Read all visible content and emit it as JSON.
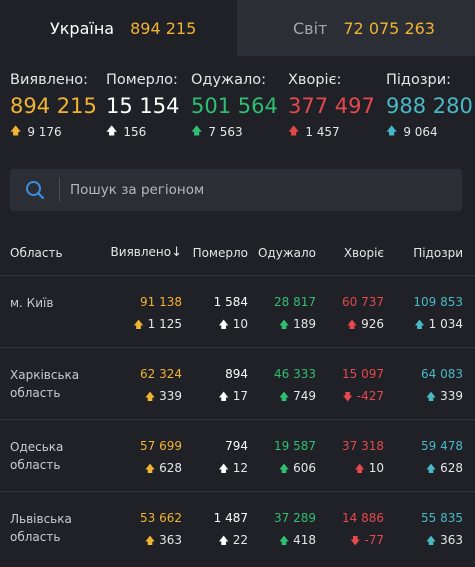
{
  "tabs": [
    {
      "name": "Україна",
      "value": "894 215"
    },
    {
      "name": "Світ",
      "value": "72 075 263"
    }
  ],
  "stats": [
    {
      "label": "Виявлено:",
      "value": "894 215",
      "delta": "9 176",
      "color": "#f2b233"
    },
    {
      "label": "Померло:",
      "value": "15 154",
      "delta": "156",
      "color": "#ffffff"
    },
    {
      "label": "Одужало:",
      "value": "501 564",
      "delta": "7 563",
      "color": "#2fbf71"
    },
    {
      "label": "Хворіє:",
      "value": "377 497",
      "delta": "1 457",
      "color": "#e5484d"
    },
    {
      "label": "Підозри:",
      "value": "988 280",
      "delta": "9 064",
      "color": "#48b9c7"
    }
  ],
  "search": {
    "placeholder": "Пошук за регіоном"
  },
  "table": {
    "headers": [
      "Область",
      "Виявлено",
      "Померло",
      "Одужало",
      "Хворіє",
      "Підозри"
    ],
    "rows": [
      {
        "region": "м. Київ",
        "cases": "91 138",
        "cases_d": "1 125",
        "deaths": "1 584",
        "deaths_d": "10",
        "recovered": "28 817",
        "recovered_d": "189",
        "sick": "60 737",
        "sick_d": "926",
        "suspected": "109 853",
        "suspected_d": "1 034",
        "sick_dir": "up"
      },
      {
        "region": "Харківська область",
        "cases": "62 324",
        "cases_d": "339",
        "deaths": "894",
        "deaths_d": "17",
        "recovered": "46 333",
        "recovered_d": "749",
        "sick": "15 097",
        "sick_d": "-427",
        "suspected": "64 083",
        "suspected_d": "339",
        "sick_dir": "down"
      },
      {
        "region": "Одеська область",
        "cases": "57 699",
        "cases_d": "628",
        "deaths": "794",
        "deaths_d": "12",
        "recovered": "19 587",
        "recovered_d": "606",
        "sick": "37 318",
        "sick_d": "10",
        "suspected": "59 478",
        "suspected_d": "628",
        "sick_dir": "up"
      },
      {
        "region": "Львівська область",
        "cases": "53 662",
        "cases_d": "363",
        "deaths": "1 487",
        "deaths_d": "22",
        "recovered": "37 289",
        "recovered_d": "418",
        "sick": "14 886",
        "sick_d": "-77",
        "suspected": "55 835",
        "suspected_d": "363",
        "sick_dir": "down"
      }
    ]
  }
}
